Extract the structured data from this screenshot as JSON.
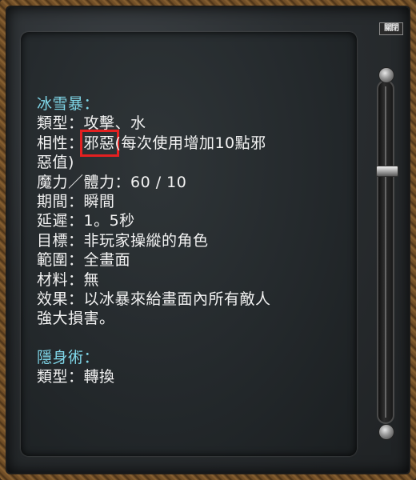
{
  "window": {
    "close_label": "關閉"
  },
  "spell1": {
    "name": "冰雪暴：",
    "type_label": "類型：",
    "type_value": "攻擊、水",
    "affinity_label": "相性：",
    "affinity_value": "邪惡",
    "affinity_note_1": "(每次使用增加10點邪",
    "affinity_note_2": "惡值)",
    "cost": "魔力／體力：60 / 10",
    "duration": "期間：瞬間",
    "delay": "延遲：1。5秒",
    "target": "目標：非玩家操縱的角色",
    "range": "範圍：全畫面",
    "material": "材料：無",
    "effect_1": "效果：以冰暴來給畫面內所有敵人",
    "effect_2": "強大損害。"
  },
  "spell2": {
    "name": "隱身術：",
    "type": "類型：轉換"
  },
  "colors": {
    "heading": "#7fd6e8",
    "text": "#f2f2f2",
    "highlight_box": "#e32020"
  }
}
